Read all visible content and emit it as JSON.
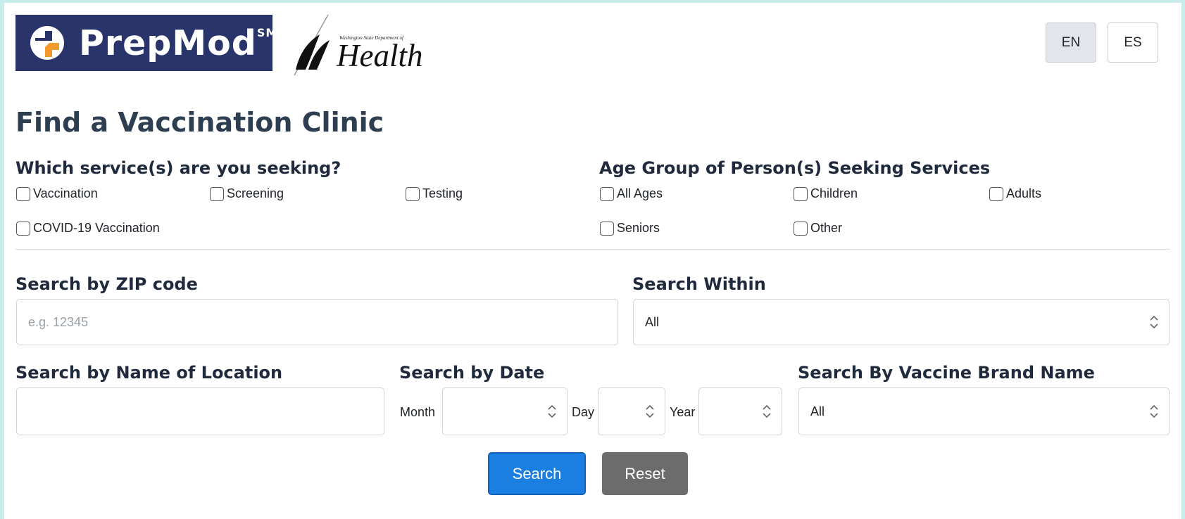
{
  "brand": {
    "prepmod_word": "PrepMod",
    "prepmod_sm": "SM",
    "doh_small": "Washington State Department of",
    "doh_big": "Health"
  },
  "lang": {
    "en": "EN",
    "es": "ES",
    "active": "EN"
  },
  "page_title": "Find a Vaccination Clinic",
  "services": {
    "title": "Which service(s) are you seeking?",
    "options": [
      "Vaccination",
      "Screening",
      "Testing",
      "COVID-19 Vaccination"
    ]
  },
  "age_groups": {
    "title": "Age Group of Person(s) Seeking Services",
    "options": [
      "All Ages",
      "Children",
      "Adults",
      "Seniors",
      "Other"
    ]
  },
  "zip": {
    "label": "Search by ZIP code",
    "placeholder": "e.g. 12345",
    "value": ""
  },
  "within": {
    "label": "Search Within",
    "value": "All"
  },
  "location": {
    "label": "Search by Name of Location",
    "value": ""
  },
  "date": {
    "label": "Search by Date",
    "month_label": "Month",
    "day_label": "Day",
    "year_label": "Year"
  },
  "brand_filter": {
    "label": "Search By Vaccine Brand Name",
    "value": "All"
  },
  "buttons": {
    "search": "Search",
    "reset": "Reset"
  },
  "colors": {
    "brand_navy": "#29346a",
    "accent_orange": "#f39a2d",
    "primary_blue": "#1a7fe0",
    "reset_gray": "#6c6c6c"
  },
  "icons": [
    "prepmod-logo-icon",
    "doh-logo-icon",
    "select-chevron-icon"
  ]
}
